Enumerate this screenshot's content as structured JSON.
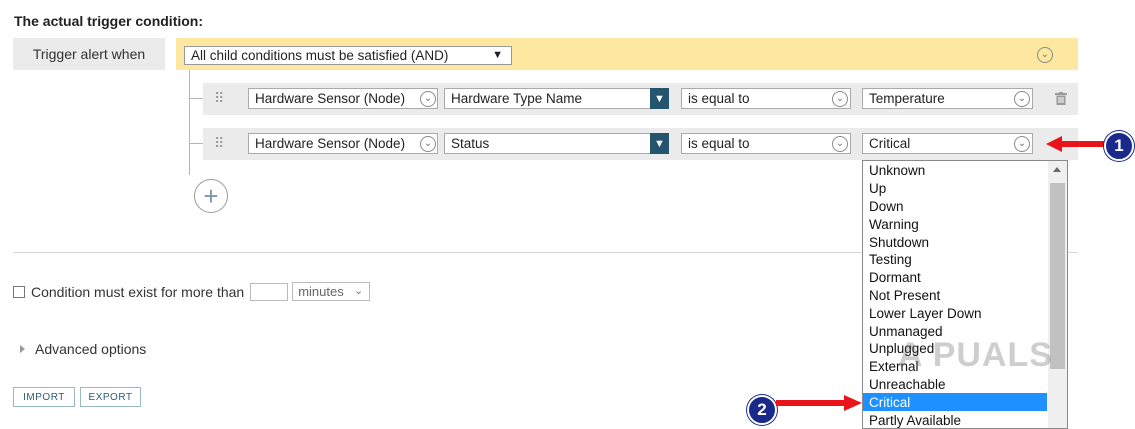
{
  "header": {
    "title": "The actual trigger condition:"
  },
  "trigger": {
    "label": "Trigger alert when",
    "logic_select": "All child conditions must be satisfied (AND)"
  },
  "conditions": [
    {
      "object": "Hardware Sensor (Node)",
      "property": "Hardware Type Name",
      "operator": "is equal to",
      "value": "Temperature"
    },
    {
      "object": "Hardware Sensor (Node)",
      "property": "Status",
      "operator": "is equal to",
      "value": "Critical"
    }
  ],
  "value_dropdown": {
    "options": [
      "Unknown",
      "Up",
      "Down",
      "Warning",
      "Shutdown",
      "Testing",
      "Dormant",
      "Not Present",
      "Lower Layer Down",
      "Unmanaged",
      "Unplugged",
      "External",
      "Unreachable",
      "Critical",
      "Partly Available"
    ],
    "selected": "Critical"
  },
  "duration": {
    "label": "Condition must exist for more than",
    "value": "",
    "unit": "minutes"
  },
  "advanced": {
    "label": "Advanced options"
  },
  "buttons": {
    "import": "IMPORT",
    "export": "EXPORT"
  },
  "annotations": {
    "badge1": "1",
    "badge2": "2",
    "arrow_color": "#e8141a",
    "badge_color": "#1a2a8a"
  },
  "watermark": "A  PUALS",
  "colors": {
    "and_bar": "#fde7a1",
    "combo_button": "#25546e",
    "selected_option": "#1e90ff"
  }
}
